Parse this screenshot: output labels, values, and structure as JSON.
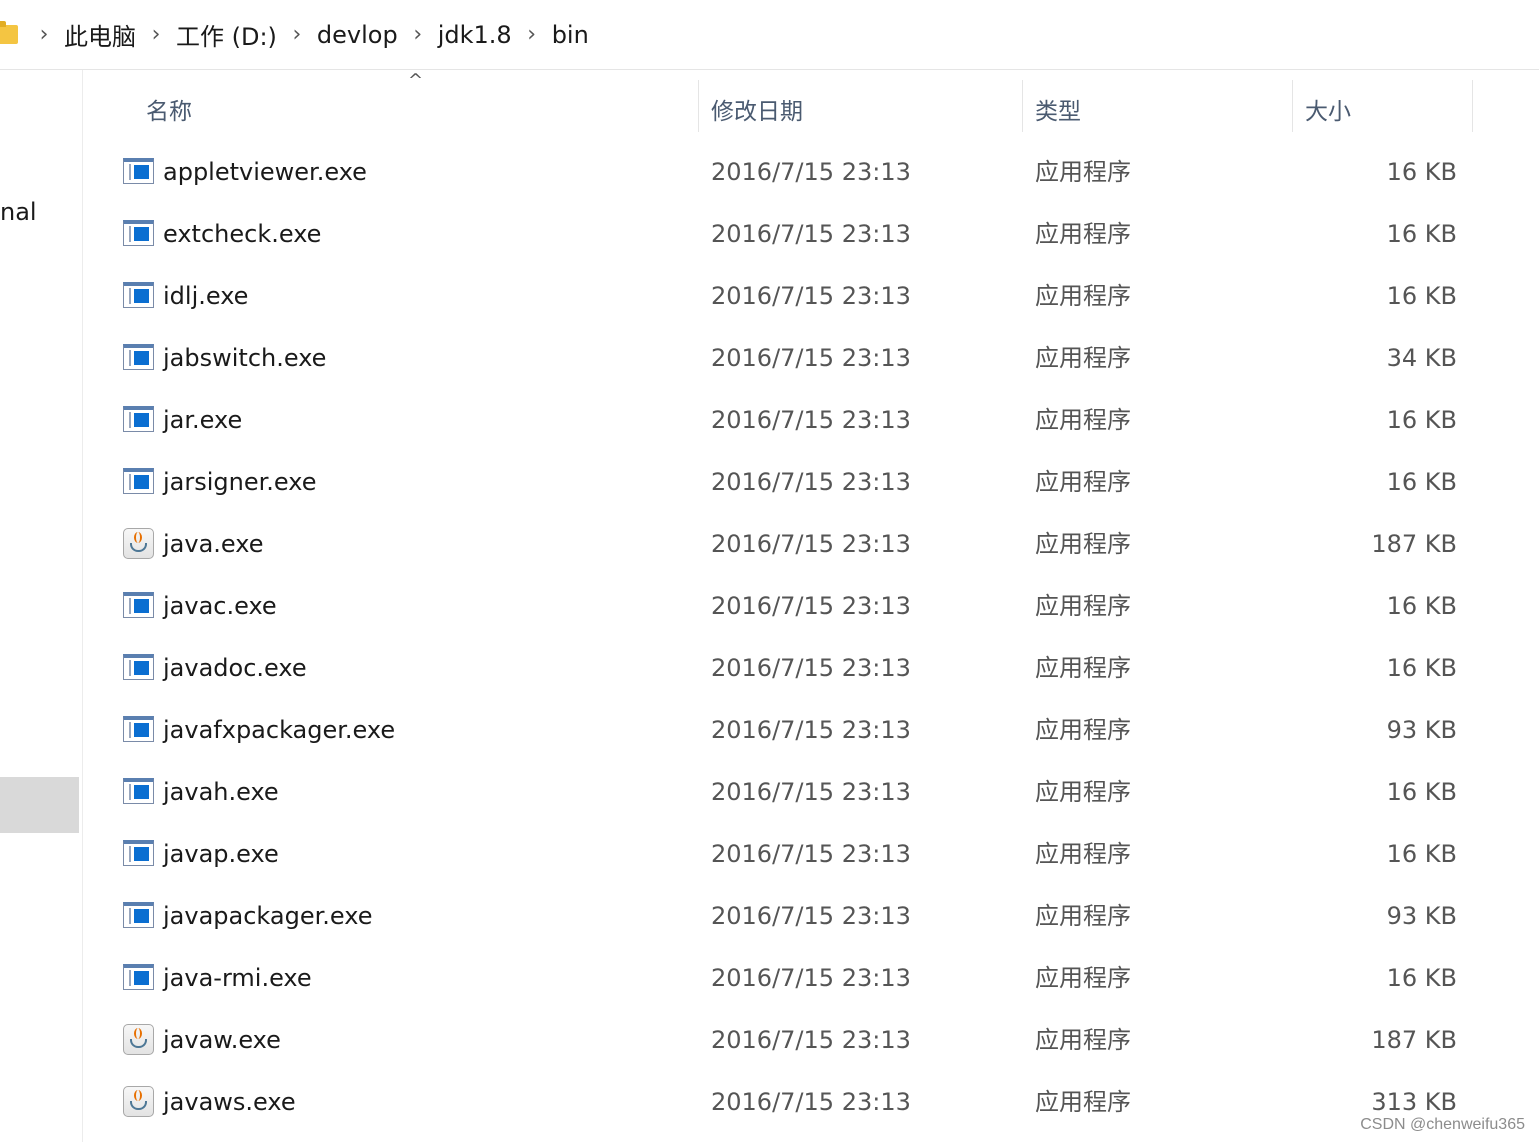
{
  "breadcrumb": [
    "此电脑",
    "工作 (D:)",
    "devlop",
    "jdk1.8",
    "bin"
  ],
  "nav": {
    "partial_label": "nal"
  },
  "columns": {
    "name": "名称",
    "date": "修改日期",
    "type": "类型",
    "size": "大小"
  },
  "files": [
    {
      "name": "appletviewer.exe",
      "date": "2016/7/15 23:13",
      "type": "应用程序",
      "size": "16 KB",
      "icon": "exe-icon"
    },
    {
      "name": "extcheck.exe",
      "date": "2016/7/15 23:13",
      "type": "应用程序",
      "size": "16 KB",
      "icon": "exe-icon"
    },
    {
      "name": "idlj.exe",
      "date": "2016/7/15 23:13",
      "type": "应用程序",
      "size": "16 KB",
      "icon": "exe-icon"
    },
    {
      "name": "jabswitch.exe",
      "date": "2016/7/15 23:13",
      "type": "应用程序",
      "size": "34 KB",
      "icon": "exe-icon"
    },
    {
      "name": "jar.exe",
      "date": "2016/7/15 23:13",
      "type": "应用程序",
      "size": "16 KB",
      "icon": "exe-icon"
    },
    {
      "name": "jarsigner.exe",
      "date": "2016/7/15 23:13",
      "type": "应用程序",
      "size": "16 KB",
      "icon": "exe-icon"
    },
    {
      "name": "java.exe",
      "date": "2016/7/15 23:13",
      "type": "应用程序",
      "size": "187 KB",
      "icon": "java-icon"
    },
    {
      "name": "javac.exe",
      "date": "2016/7/15 23:13",
      "type": "应用程序",
      "size": "16 KB",
      "icon": "exe-icon"
    },
    {
      "name": "javadoc.exe",
      "date": "2016/7/15 23:13",
      "type": "应用程序",
      "size": "16 KB",
      "icon": "exe-icon"
    },
    {
      "name": "javafxpackager.exe",
      "date": "2016/7/15 23:13",
      "type": "应用程序",
      "size": "93 KB",
      "icon": "exe-icon"
    },
    {
      "name": "javah.exe",
      "date": "2016/7/15 23:13",
      "type": "应用程序",
      "size": "16 KB",
      "icon": "exe-icon"
    },
    {
      "name": "javap.exe",
      "date": "2016/7/15 23:13",
      "type": "应用程序",
      "size": "16 KB",
      "icon": "exe-icon"
    },
    {
      "name": "javapackager.exe",
      "date": "2016/7/15 23:13",
      "type": "应用程序",
      "size": "93 KB",
      "icon": "exe-icon"
    },
    {
      "name": "java-rmi.exe",
      "date": "2016/7/15 23:13",
      "type": "应用程序",
      "size": "16 KB",
      "icon": "exe-icon"
    },
    {
      "name": "javaw.exe",
      "date": "2016/7/15 23:13",
      "type": "应用程序",
      "size": "187 KB",
      "icon": "java-icon"
    },
    {
      "name": "javaws.exe",
      "date": "2016/7/15 23:13",
      "type": "应用程序",
      "size": "313 KB",
      "icon": "java-icon"
    }
  ],
  "watermark": "CSDN @chenweifu365"
}
